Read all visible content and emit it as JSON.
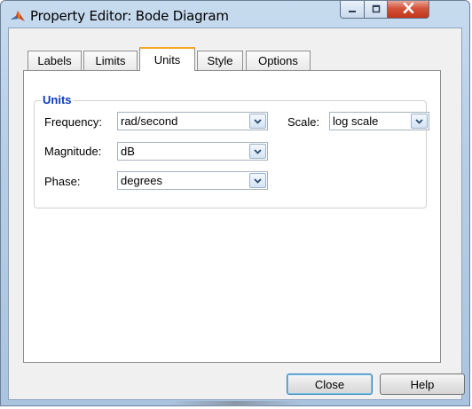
{
  "window": {
    "title": "Property Editor: Bode Diagram",
    "app_icon": "matlab-logo-icon",
    "controls": {
      "minimize_icon": "minimize-icon",
      "maximize_icon": "maximize-icon",
      "close_icon": "close-icon"
    }
  },
  "tabs": [
    {
      "label": "Labels",
      "active": false
    },
    {
      "label": "Limits",
      "active": false
    },
    {
      "label": "Units",
      "active": true
    },
    {
      "label": "Style",
      "active": false
    },
    {
      "label": "Options",
      "active": false
    }
  ],
  "units_group": {
    "title": "Units",
    "frequency": {
      "label": "Frequency:",
      "value": "rad/second"
    },
    "scale": {
      "label": "Scale:",
      "value": "log scale"
    },
    "magnitude": {
      "label": "Magnitude:",
      "value": "dB"
    },
    "phase": {
      "label": "Phase:",
      "value": "degrees"
    }
  },
  "buttons": {
    "close": "Close",
    "help": "Help"
  },
  "colors": {
    "active_tab_accent": "#f6a623",
    "group_title": "#0b3bbf",
    "close_button": "#c3351a"
  }
}
